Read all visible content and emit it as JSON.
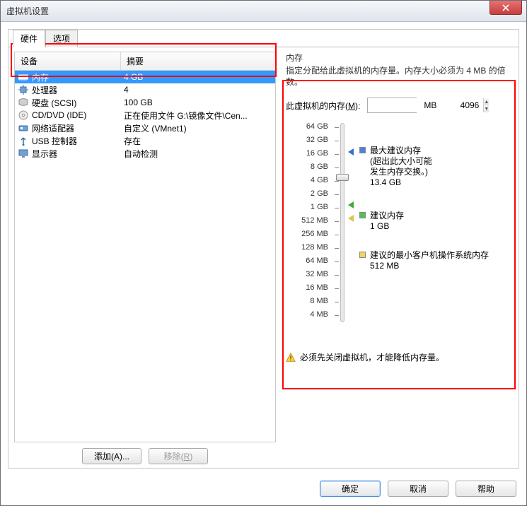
{
  "window": {
    "title": "虚拟机设置"
  },
  "tabs": {
    "hardware": "硬件",
    "options": "选项"
  },
  "columns": {
    "device": "设备",
    "summary": "摘要"
  },
  "devices": [
    {
      "name": "内存",
      "summary": "4 GB",
      "icon": "memory",
      "selected": true
    },
    {
      "name": "处理器",
      "summary": "4",
      "icon": "cpu"
    },
    {
      "name": "硬盘 (SCSI)",
      "summary": "100 GB",
      "icon": "disk"
    },
    {
      "name": "CD/DVD (IDE)",
      "summary": "正在使用文件 G:\\镜像文件\\Cen...",
      "icon": "cd"
    },
    {
      "name": "网络适配器",
      "summary": "自定义 (VMnet1)",
      "icon": "net"
    },
    {
      "name": "USB 控制器",
      "summary": "存在",
      "icon": "usb"
    },
    {
      "name": "显示器",
      "summary": "自动检测",
      "icon": "display"
    }
  ],
  "left_buttons": {
    "add": "添加(A)...",
    "remove": "移除(R)"
  },
  "mem": {
    "title": "内存",
    "desc": "指定分配给此虚拟机的内存量。内存大小必须为 4 MB 的倍数。",
    "label": "此虚拟机的内存(M):",
    "value": "4096",
    "unit": "MB",
    "scale": [
      "64 GB",
      "32 GB",
      "16 GB",
      "8 GB",
      "4 GB",
      "2 GB",
      "1 GB",
      "512 MB",
      "256 MB",
      "128 MB",
      "64 MB",
      "32 MB",
      "16 MB",
      "8 MB",
      "4 MB"
    ],
    "legend": {
      "max": {
        "t1": "最大建议内存",
        "t2": "(超出此大小可能",
        "t3": "发生内存交换。)",
        "val": "13.4 GB"
      },
      "rec": {
        "t1": "建议内存",
        "val": "1 GB"
      },
      "min": {
        "t1": "建议的最小客户机操作系统内存",
        "val": "512 MB"
      }
    },
    "warn": "必须先关闭虚拟机，才能降低内存量。"
  },
  "footer": {
    "ok": "确定",
    "cancel": "取消",
    "help": "帮助"
  }
}
